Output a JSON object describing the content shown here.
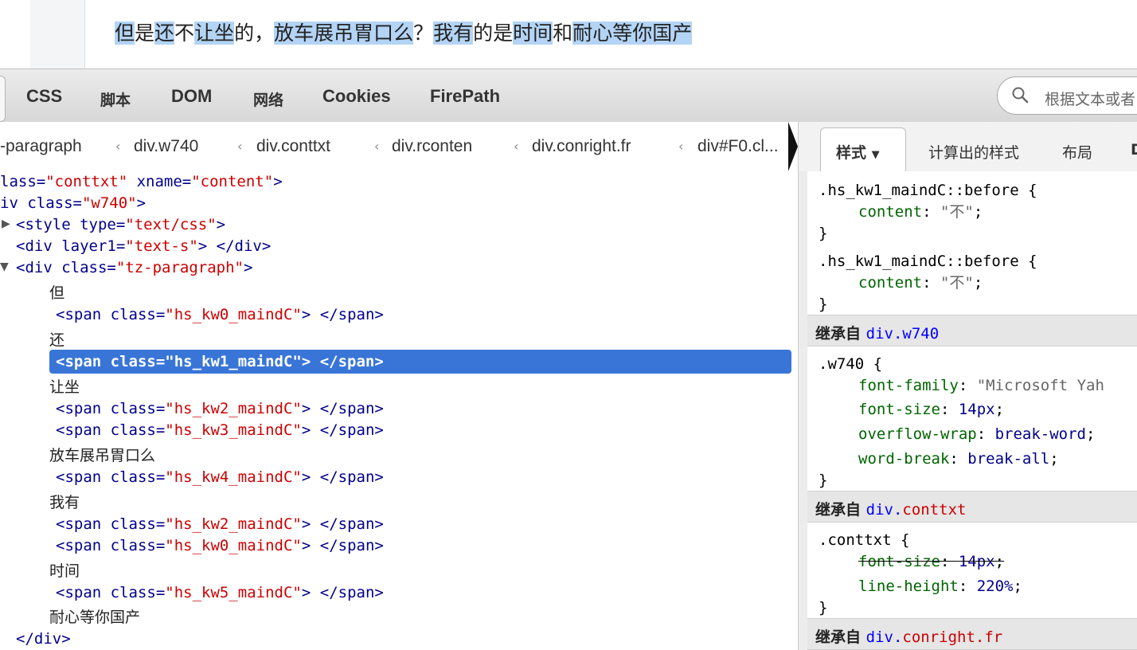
{
  "page": {
    "paragraph": [
      {
        "text": "但",
        "hl": true
      },
      {
        "text": "是",
        "hl": false
      },
      {
        "text": "还",
        "hl": true
      },
      {
        "text": "不",
        "hl": false
      },
      {
        "text": "让坐",
        "hl": true
      },
      {
        "text": "的，",
        "hl": false
      },
      {
        "text": "放车展吊胃口么",
        "hl": true
      },
      {
        "text": "？",
        "hl": false
      },
      {
        "text": "我有",
        "hl": true
      },
      {
        "text": "的是",
        "hl": false
      },
      {
        "text": "时间",
        "hl": true
      },
      {
        "text": "和",
        "hl": false
      },
      {
        "text": "耐心等你国产",
        "hl": true
      }
    ]
  },
  "tabs": {
    "css": "CSS",
    "script": "脚本",
    "dom": "DOM",
    "net": "网络",
    "cookies": "Cookies",
    "firepath": "FirePath"
  },
  "search": {
    "placeholder": "根据文本或者"
  },
  "breadcrumbs": [
    "-paragraph",
    "div.w740",
    "div.conttxt",
    "div.rconten",
    "div.conright.fr",
    "div#F0.cl..."
  ],
  "side_tabs": {
    "styles": "样式",
    "computed": "计算出的样式",
    "layout": "布局",
    "more": "D"
  },
  "tree": {
    "l1": {
      "pre": "lass=",
      "v1": "\"conttxt\"",
      "mid": " xname=",
      "v2": "\"content\"",
      "end": ">"
    },
    "l2": {
      "pre": "iv class=",
      "v1": "\"w740\"",
      "end": ">"
    },
    "l3": {
      "pre": "<style type=",
      "v1": "\"text/css\"",
      "end": ">"
    },
    "l4": {
      "pre": "<div layer1=",
      "v1": "\"text-s\"",
      "end": "> </div>"
    },
    "l5": {
      "pre": "<div class=",
      "v1": "\"tz-paragraph\"",
      "end": ">"
    },
    "t1": "但",
    "s1": {
      "pre": "<span class=",
      "v1": "\"hs_kw0_maindC\"",
      "end": "> </span>"
    },
    "t2": "还",
    "s2": {
      "full": "<span class=\"hs_kw1_maindC\"> </span>"
    },
    "t3": "让坐",
    "s3": {
      "pre": "<span class=",
      "v1": "\"hs_kw2_maindC\"",
      "end": "> </span>"
    },
    "s4": {
      "pre": "<span class=",
      "v1": "\"hs_kw3_maindC\"",
      "end": "> </span>"
    },
    "t4": "放车展吊胃口么",
    "s5": {
      "pre": "<span class=",
      "v1": "\"hs_kw4_maindC\"",
      "end": "> </span>"
    },
    "t5": "我有",
    "s6": {
      "pre": "<span class=",
      "v1": "\"hs_kw2_maindC\"",
      "end": "> </span>"
    },
    "s7": {
      "pre": "<span class=",
      "v1": "\"hs_kw0_maindC\"",
      "end": "> </span>"
    },
    "t6": "时间",
    "s8": {
      "pre": "<span class=",
      "v1": "\"hs_kw5_maindC\"",
      "end": "> </span>"
    },
    "t7": "耐心等你国产",
    "close": "</div>"
  },
  "styles": {
    "r1": {
      "sel": ".hs_kw1_maindC::before {",
      "prop": "content",
      "val": "\"不\"",
      "close": "}"
    },
    "r2": {
      "sel": ".hs_kw1_maindC::before {",
      "prop": "content",
      "val": "\"不\"",
      "close": "}"
    },
    "inh1": {
      "label": "继承自",
      "link": "div.w740"
    },
    "r3": {
      "sel": ".w740 {",
      "p1": "font-family",
      "v1": "\"Microsoft Yah",
      "p2": "font-size",
      "v2": "14px",
      "p3": "overflow-wrap",
      "v3": "break-word",
      "p4": "word-break",
      "v4": "break-all",
      "close": "}"
    },
    "inh2": {
      "label": "继承自",
      "link": "div.",
      "link2": "conttxt"
    },
    "r4": {
      "sel": ".conttxt {",
      "p1": "font-size",
      "v1": "14px",
      "p2": "line-height",
      "v2": "220%",
      "close": "}"
    },
    "inh3": {
      "label": "继承自",
      "link": "div.",
      "link2": "conright.fr"
    }
  }
}
